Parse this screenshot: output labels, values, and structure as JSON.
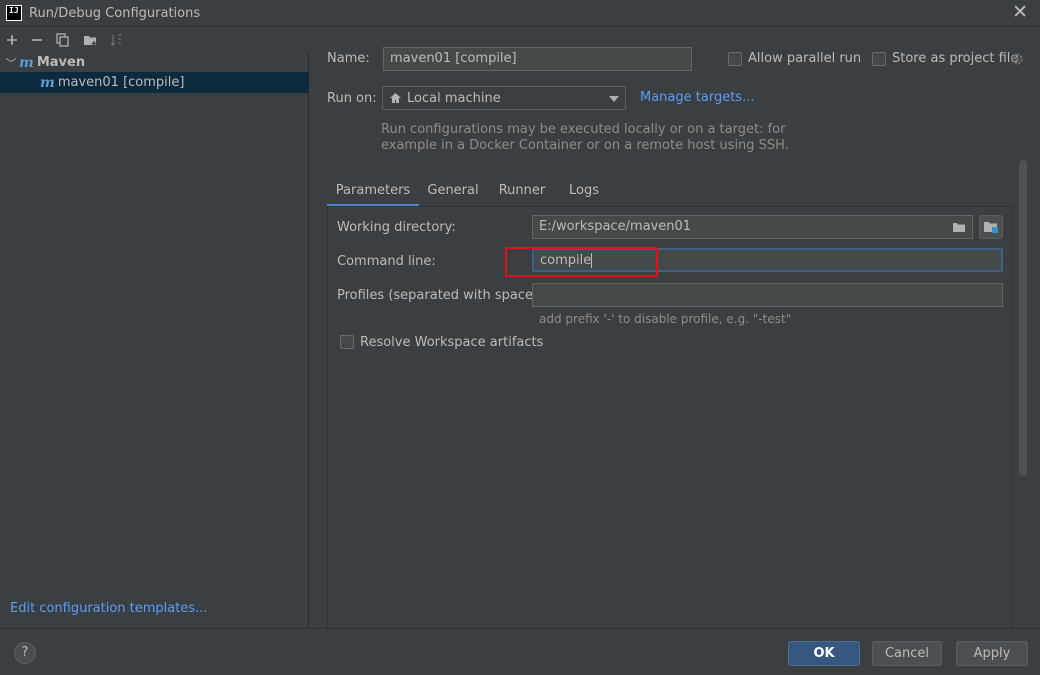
{
  "window": {
    "title": "Run/Debug Configurations",
    "app_icon_text": "IJ"
  },
  "toolbar": {
    "buttons": [
      "add-icon",
      "remove-icon",
      "copy-icon",
      "folder-add-icon",
      "sort-icon"
    ]
  },
  "tree": {
    "group": {
      "label": "Maven",
      "icon": "maven-icon",
      "expanded": true
    },
    "items": [
      {
        "label": "maven01 [compile]",
        "icon": "maven-icon",
        "selected": true
      }
    ]
  },
  "left_footer": {
    "edit_templates": "Edit configuration templates..."
  },
  "form": {
    "name_label": "Name:",
    "name_value": "maven01 [compile]",
    "allow_parallel_label": "Allow parallel run",
    "store_project_label": "Store as project file",
    "run_on_label": "Run on:",
    "run_on_value": "Local machine",
    "manage_targets": "Manage targets...",
    "run_on_hint_1": "Run configurations may be executed locally or on a target: for",
    "run_on_hint_2": "example in a Docker Container or on a remote host using SSH."
  },
  "tabs": [
    "Parameters",
    "General",
    "Runner",
    "Logs"
  ],
  "active_tab": "Parameters",
  "parameters": {
    "working_dir_label": "Working directory:",
    "working_dir_value": "E:/workspace/maven01",
    "command_line_label": "Command line:",
    "command_line_value": "compile",
    "profiles_label": "Profiles (separated with space):",
    "profiles_value": "",
    "profiles_hint": "add prefix '-' to disable profile, e.g. \"-test\"",
    "resolve_label": "Resolve Workspace artifacts"
  },
  "buttons": {
    "ok": "OK",
    "cancel": "Cancel",
    "apply": "Apply",
    "help": "?"
  },
  "colors": {
    "accent": "#589df6",
    "highlight_box": "#e0111b",
    "selection": "#0d293e",
    "primary_button": "#365880"
  }
}
